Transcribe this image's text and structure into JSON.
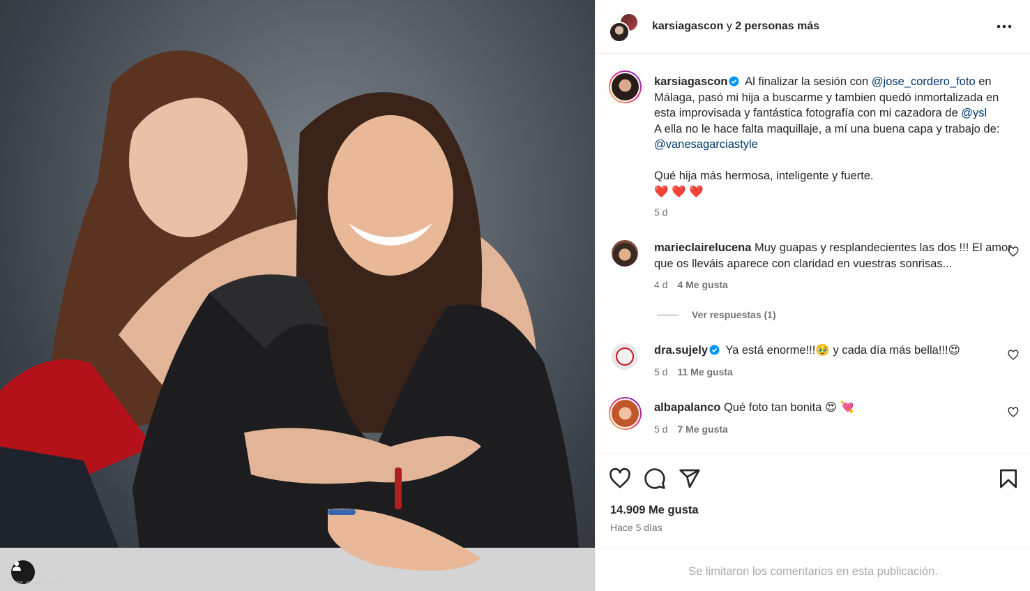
{
  "post": {
    "author": "karsiagascon",
    "coauthors_text": "y",
    "coauthors_more": "2 personas más",
    "photo_watermark": "@jose_cordero_foto"
  },
  "caption": {
    "username": "karsiagascon",
    "text_1": "Al finalizar la sesión con",
    "mention_1": "@jose_cordero_foto",
    "text_2": "en Málaga, pasó mi hija a buscarme y tambien quedó inmortalizada en esta improvisada y fantástica fotografía con mi cazadora de",
    "mention_2": "@ysl",
    "text_3": "A ella no le hace falta maquillaje, a mí una buena capa y trabajo de:",
    "mention_3": "@vanesagarciastyle",
    "text_4": "Qué hija más hermosa, inteligente y fuerte.",
    "hearts": "❤️ ❤️ ❤️",
    "age": "5 d"
  },
  "comments": [
    {
      "username": "marieclairelucena",
      "text": "Muy guapas y resplandecientes las dos !!! El amor que os lleváis aparece con claridad en vuestras sonrisas...",
      "age": "4 d",
      "likes": "4 Me gusta",
      "replies_label": "Ver respuestas (1)"
    },
    {
      "username": "dra.sujely",
      "text": "Ya está enorme!!!🥹  y cada día más bella!!!😍",
      "age": "5 d",
      "likes": "11 Me gusta"
    },
    {
      "username": "albapalanco",
      "text": "Qué foto tan bonita 😍 💘",
      "age": "5 d",
      "likes": "7 Me gusta"
    }
  ],
  "footer": {
    "likes": "14.909 Me gusta",
    "time": "Hace 5 días",
    "limited_notice": "Se limitaron los comentarios en esta publicación."
  },
  "icons": {
    "like": "heart-icon",
    "comment": "comment-icon",
    "share": "share-icon",
    "save": "bookmark-icon",
    "more": "more-options-icon",
    "verified": "verified-badge-icon",
    "tag": "user-tag-icon"
  },
  "colors": {
    "link": "#00376b",
    "verified": "#0095f6",
    "muted": "#737373",
    "border": "#efefef"
  }
}
